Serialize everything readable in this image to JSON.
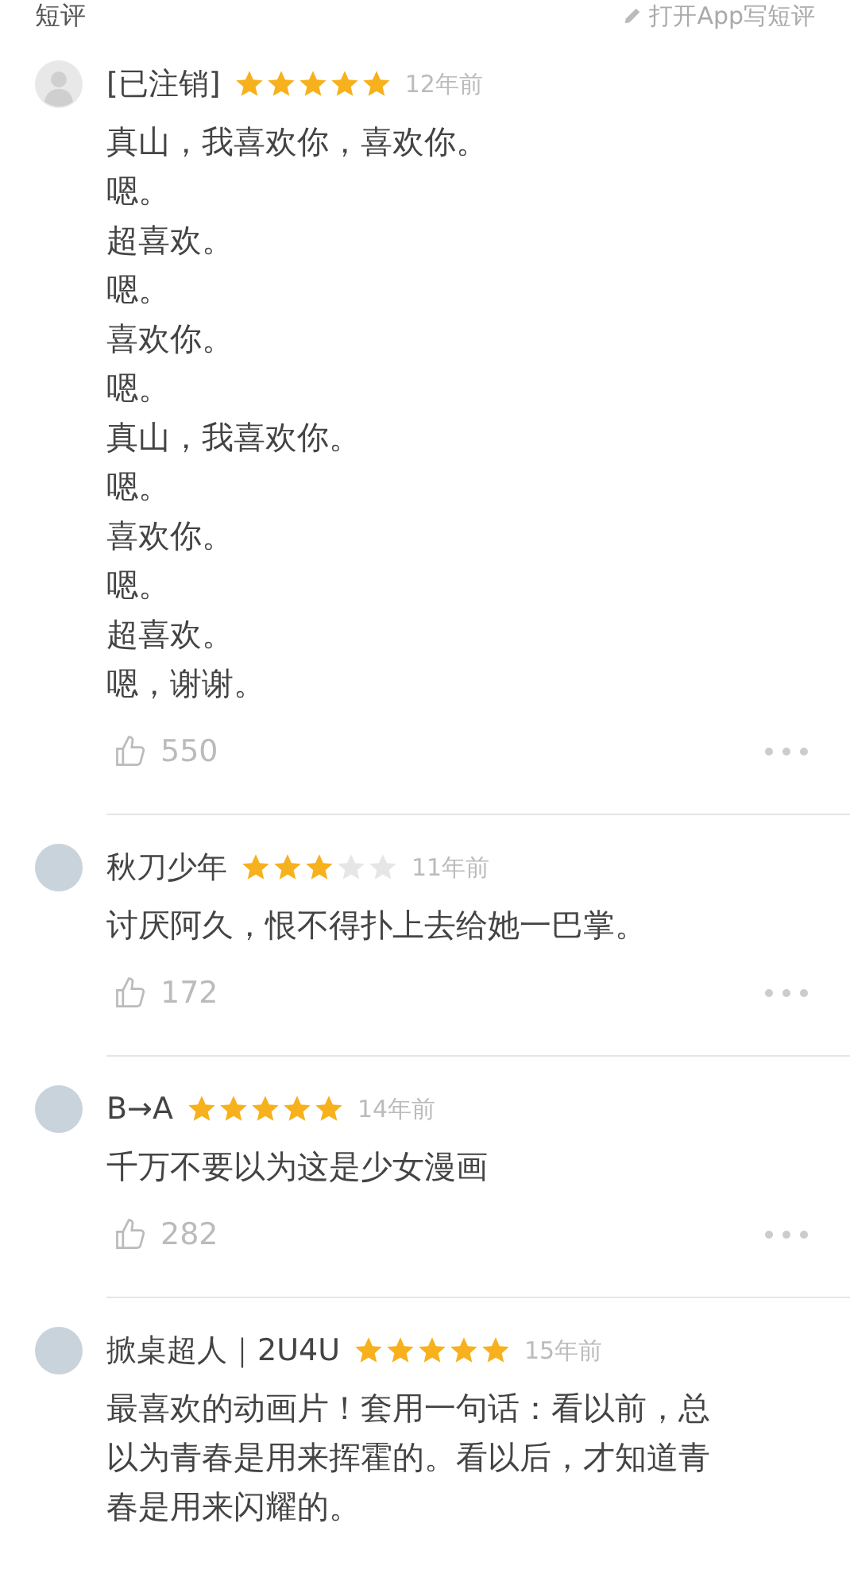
{
  "header": {
    "title": "短评",
    "action": "打开App写短评"
  },
  "reviews": [
    {
      "user": "[已注销]",
      "kind": "default",
      "stars": 5,
      "time": "12年前",
      "lines": [
        "真山，我喜欢你，喜欢你。",
        "嗯。",
        "超喜欢。",
        "嗯。",
        "喜欢你。",
        "嗯。",
        "真山，我喜欢你。",
        "嗯。",
        "喜欢你。",
        "嗯。",
        "超喜欢。",
        "嗯，谢谢。"
      ],
      "likes": "550"
    },
    {
      "user": "秋刀少年",
      "kind": "photo",
      "stars": 3,
      "time": "11年前",
      "lines": [
        "讨厌阿久，恨不得扑上去给她一巴掌。"
      ],
      "likes": "172"
    },
    {
      "user": "B→A",
      "kind": "photo",
      "stars": 5,
      "time": "14年前",
      "lines": [
        "千万不要以为这是少女漫画"
      ],
      "likes": "282"
    },
    {
      "user": "掀桌超人｜2U4U",
      "kind": "photo",
      "stars": 5,
      "time": "15年前",
      "lines": [
        "最喜欢的动画片！套用一句话：看以前，总以为青春是用来挥霍的。看以后，才知道青春是用来闪耀的。"
      ]
    }
  ]
}
